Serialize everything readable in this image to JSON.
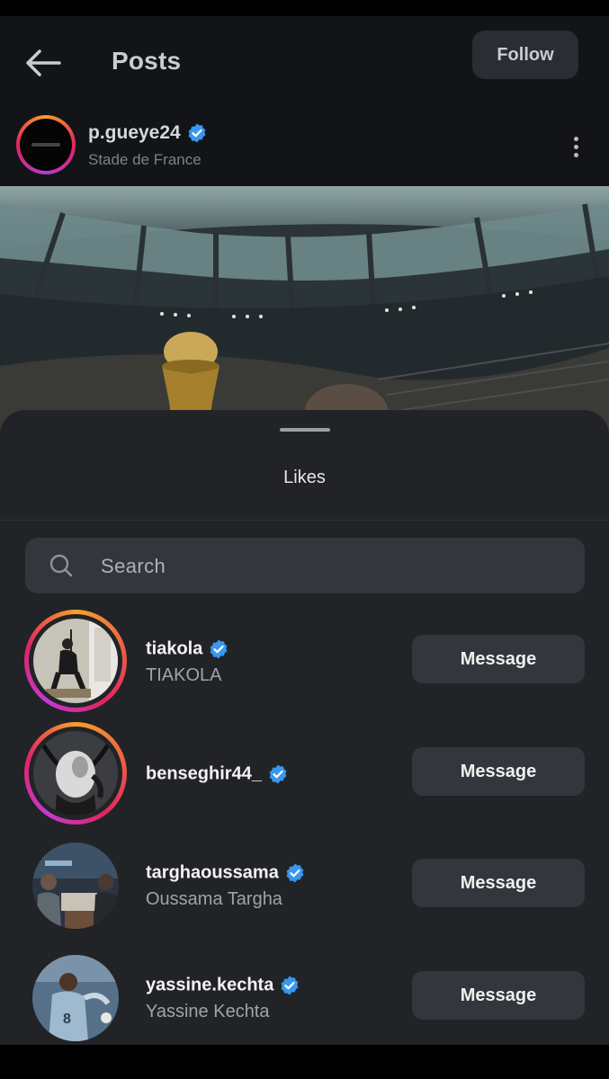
{
  "header": {
    "title": "Posts",
    "follow_label": "Follow"
  },
  "post": {
    "username": "p.gueye24",
    "location": "Stade de France"
  },
  "likes_sheet": {
    "title": "Likes",
    "search_placeholder": "Search",
    "users": [
      {
        "username": "tiakola",
        "full_name": "TIAKOLA",
        "verified": true,
        "action": "Message"
      },
      {
        "username": "benseghir44_",
        "full_name": "",
        "verified": true,
        "action": "Message"
      },
      {
        "username": "targhaoussama",
        "full_name": "Oussama Targha",
        "verified": true,
        "action": "Message"
      },
      {
        "username": "yassine.kechta",
        "full_name": "Yassine Kechta",
        "verified": true,
        "action": "Message"
      }
    ]
  },
  "colors": {
    "verified": "#3897f0",
    "story_ring_start": "#f7a02a",
    "story_ring_end": "#c23ad3"
  }
}
